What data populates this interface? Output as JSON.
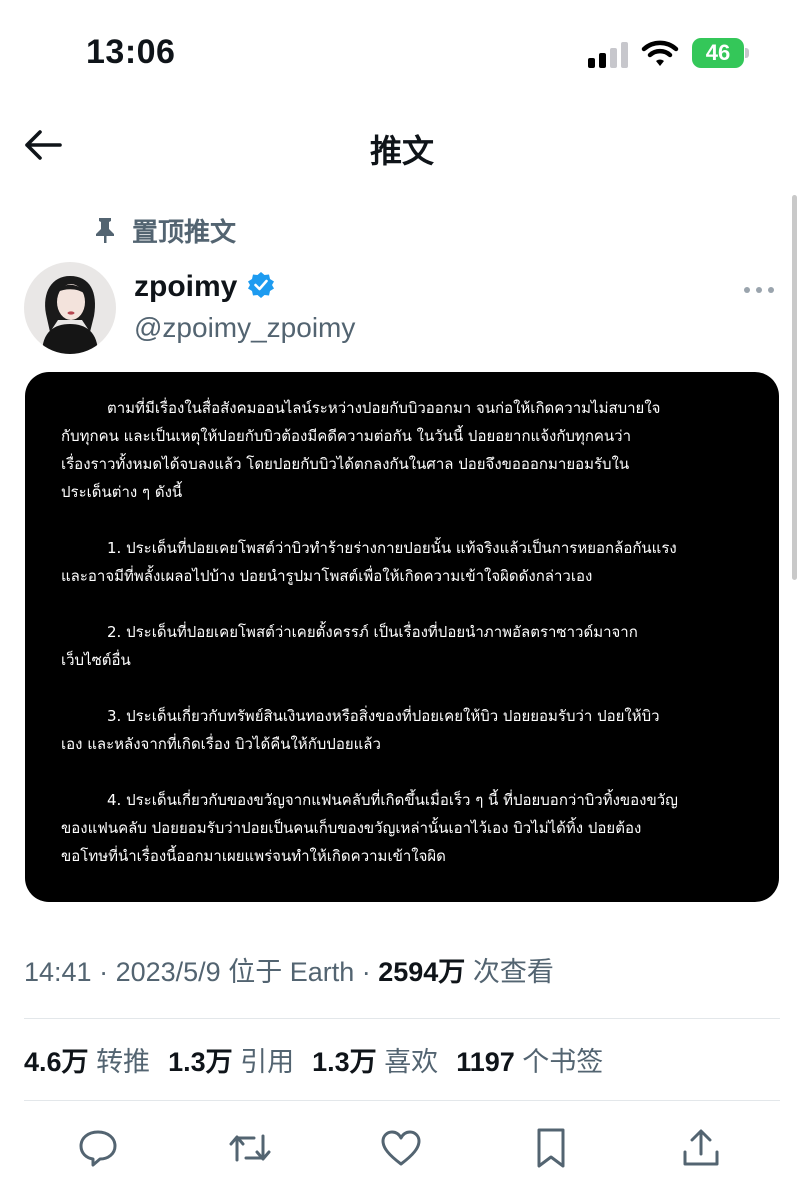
{
  "status_bar": {
    "time": "13:06",
    "battery": "46"
  },
  "nav": {
    "title": "推文"
  },
  "tweet": {
    "pinned_label": "置顶推文",
    "display_name": "zpoimy",
    "handle": "@zpoimy_zpoimy",
    "image_text": {
      "p1": [
        "ตามที่มีเรื่องในสื่อสังคมออนไลน์ระหว่างปอยกับบิวออกมา จนก่อให้เกิดความไม่สบายใจ",
        "กับทุกคน และเป็นเหตุให้ปอยกับบิวต้องมีคดีความต่อกัน ในวันนี้ ปอยอยากแจ้งกับทุกคนว่า",
        "เรื่องราวทั้งหมดได้จบลงแล้ว โดยปอยกับบิวได้ตกลงกันในศาล ปอยจึงขอออกมายอมรับใน",
        "ประเด็นต่าง ๆ ดังนี้"
      ],
      "p2": [
        "1. ประเด็นที่ปอยเคยโพสต์ว่าบิวทำร้ายร่างกายปอยนั้น แท้จริงแล้วเป็นการหยอกล้อกันแรง",
        "และอาจมีที่พลั้งเผลอไปบ้าง ปอยนำรูปมาโพสต์เพื่อให้เกิดความเข้าใจผิดดังกล่าวเอง"
      ],
      "p3": [
        "2. ประเด็นที่ปอยเคยโพสต์ว่าเคยตั้งครรภ์ เป็นเรื่องที่ปอยนำภาพอัลตราซาวด์มาจาก",
        "เว็บไซต์อื่น"
      ],
      "p4": [
        "3. ประเด็นเกี่ยวกับทรัพย์สินเงินทองหรือสิ่งของที่ปอยเคยให้บิว ปอยยอมรับว่า ปอยให้บิว",
        "เอง และหลังจากที่เกิดเรื่อง บิวได้คืนให้กับปอยแล้ว"
      ],
      "p5": [
        "4. ประเด็นเกี่ยวกับของขวัญจากแฟนคลับที่เกิดขึ้นเมื่อเร็ว ๆ นี้ ที่ปอยบอกว่าบิวทิ้งของขวัญ",
        "ของแฟนคลับ ปอยยอมรับว่าปอยเป็นคนเก็บของขวัญเหล่านั้นเอาไว้เอง บิวไม่ได้ทิ้ง ปอยต้อง",
        "ขอโทษที่นำเรื่องนี้ออกมาเผยแพร่จนทำให้เกิดความเข้าใจผิด"
      ]
    },
    "meta": {
      "time": "14:41",
      "sep1": " · ",
      "date": "2023/5/9",
      "location": " 位于 Earth",
      "sep2": " · ",
      "views": "2594万",
      "views_label": " 次查看"
    },
    "stats": {
      "retweets": "4.6万",
      "retweets_label": "转推",
      "quotes": "1.3万",
      "quotes_label": "引用",
      "likes": "1.3万",
      "likes_label": "喜欢",
      "bookmarks": "1197",
      "bookmarks_label": "个书签"
    }
  },
  "colors": {
    "verified": "#1d9bf0",
    "battery": "#34c759",
    "muted": "#536471"
  },
  "icons": [
    "back-arrow-icon",
    "pin-icon",
    "verified-badge-icon",
    "more-icon",
    "reply-icon",
    "retweet-icon",
    "like-icon",
    "bookmark-icon",
    "share-icon"
  ]
}
